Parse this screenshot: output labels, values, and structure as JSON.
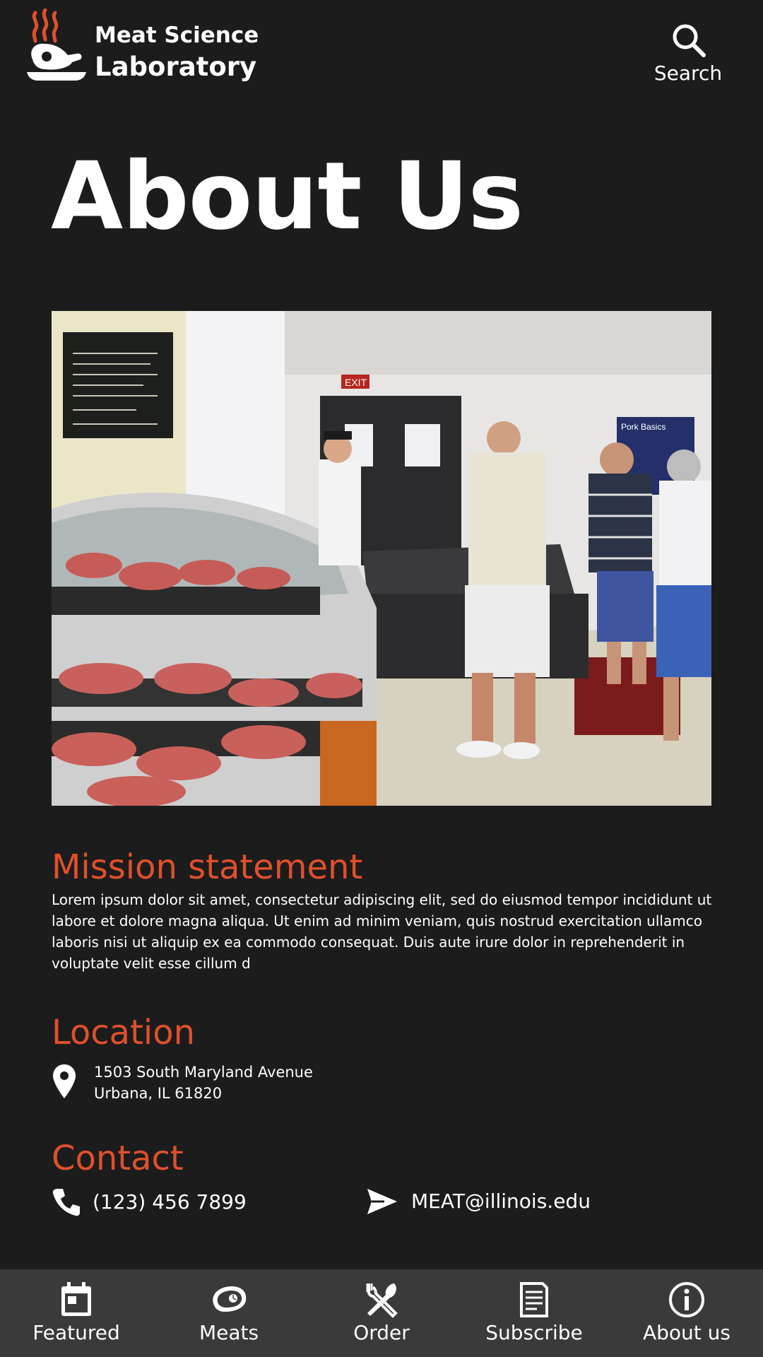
{
  "header": {
    "brand_line1": "Meat Science",
    "brand_line2": "Laboratory",
    "logo_icon": "ham-plate-icon",
    "search_icon": "search-icon",
    "search_label": "Search"
  },
  "page": {
    "title": "About Us"
  },
  "hero": {
    "image_alt": "Customers at the meat display counter",
    "sign_text": "Pork Basics",
    "exit_text": "EXIT"
  },
  "mission": {
    "heading": "Mission statement",
    "body": "Lorem ipsum dolor sit amet, consectetur adipiscing elit, sed do eiusmod tempor incididunt ut labore et dolore magna aliqua. Ut enim ad minim veniam, quis nostrud exercitation ullamco laboris nisi ut aliquip ex ea commodo consequat. Duis aute irure dolor in reprehenderit in voluptate velit esse cillum d"
  },
  "location": {
    "heading": "Location",
    "icon": "map-pin-icon",
    "address_line1": "1503 South Maryland Avenue",
    "address_line2": "Urbana, IL 61820"
  },
  "contact": {
    "heading": "Contact",
    "phone_icon": "phone-icon",
    "phone": "(123) 456 7899",
    "email_icon": "send-icon",
    "email": "MEAT@illinois.edu"
  },
  "nav": {
    "items": [
      {
        "label": "Featured",
        "icon": "calendar-icon"
      },
      {
        "label": "Meats",
        "icon": "steak-icon"
      },
      {
        "label": "Order",
        "icon": "fork-knife-icon"
      },
      {
        "label": "Subscribe",
        "icon": "document-icon"
      },
      {
        "label": "About us",
        "icon": "info-icon"
      }
    ]
  },
  "colors": {
    "background": "#1c1c1d",
    "accent": "#e0502b",
    "nav_background": "#3a3a3b",
    "text": "#ffffff"
  }
}
